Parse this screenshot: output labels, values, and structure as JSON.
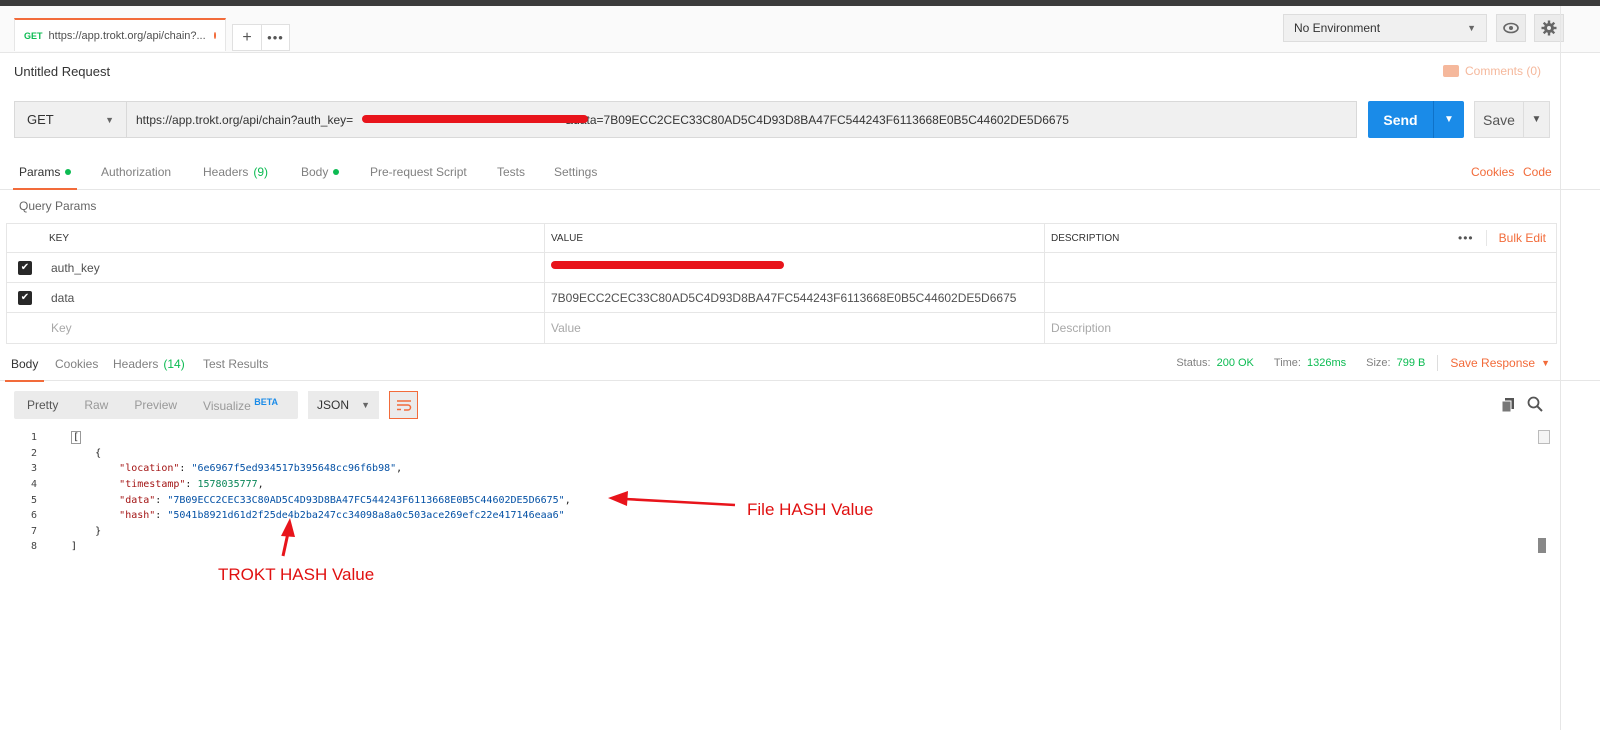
{
  "tab": {
    "method": "GET",
    "url": "https://app.trokt.org/api/chain?..."
  },
  "environment": {
    "selected": "No Environment"
  },
  "request": {
    "title": "Untitled Request",
    "comments": "Comments (0)",
    "method": "GET",
    "url_prefix": "https://app.trokt.org/api/chain?auth_key=",
    "url_suffix": "&data=7B09ECC2CEC33C80AD5C4D93D8BA47FC544243F6113668E0B5C44602DE5D6675",
    "send": "Send",
    "save": "Save"
  },
  "request_tabs": {
    "params": "Params",
    "authorization": "Authorization",
    "headers": "Headers",
    "headers_count": "(9)",
    "body": "Body",
    "prerequest": "Pre-request Script",
    "tests": "Tests",
    "settings": "Settings",
    "cookies": "Cookies",
    "code": "Code"
  },
  "params": {
    "title": "Query Params",
    "col_key": "KEY",
    "col_value": "VALUE",
    "col_description": "DESCRIPTION",
    "bulk_edit": "Bulk Edit",
    "rows": [
      {
        "key": "auth_key",
        "value": "",
        "checked": true
      },
      {
        "key": "data",
        "value": "7B09ECC2CEC33C80AD5C4D93D8BA47FC544243F6113668E0B5C44602DE5D6675",
        "checked": true
      }
    ],
    "placeholder_key": "Key",
    "placeholder_value": "Value",
    "placeholder_description": "Description"
  },
  "response_tabs": {
    "body": "Body",
    "cookies": "Cookies",
    "headers": "Headers",
    "headers_count": "(14)",
    "test_results": "Test Results"
  },
  "response_status": {
    "status_label": "Status:",
    "status": "200 OK",
    "time_label": "Time:",
    "time": "1326ms",
    "size_label": "Size:",
    "size": "799 B",
    "save_response": "Save Response"
  },
  "view": {
    "pretty": "Pretty",
    "raw": "Raw",
    "preview": "Preview",
    "visualize": "Visualize",
    "beta": "BETA",
    "format": "JSON"
  },
  "response_body": {
    "location_key": "\"location\"",
    "location": "\"6e6967f5ed934517b395648cc96f6b98\"",
    "timestamp_key": "\"timestamp\"",
    "timestamp": "1578035777",
    "data_key": "\"data\"",
    "data": "\"7B09ECC2CEC33C80AD5C4D93D8BA47FC544243F6113668E0B5C44602DE5D6675\"",
    "hash_key": "\"hash\"",
    "hash": "\"5041b8921d61d2f25de4b2ba247cc34098a8a0c503ace269efc22e417146eaa6\""
  },
  "annotations": {
    "file_hash": "File HASH Value",
    "trokt_hash": "TROKT HASH Value",
    "color": "#e01010"
  },
  "colors": {
    "accent": "#f26b3a",
    "send": "#1a8be8",
    "success": "#0cbb52"
  }
}
